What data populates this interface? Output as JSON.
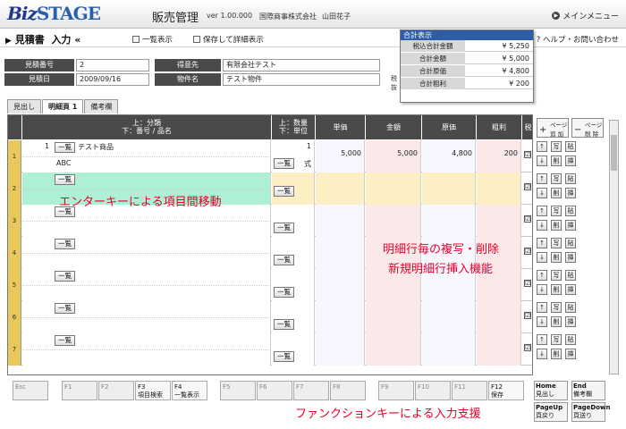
{
  "header": {
    "logo_part1": "Biz",
    "logo_part2": "STAGE",
    "app_name": "販売管理",
    "version": "ver 1.00.000",
    "company": "国際商事株式会社",
    "user": "山田花子",
    "main_menu": "メインメニュー"
  },
  "toolbar": {
    "title": "見積書",
    "mode": "入力",
    "list_view": "一覧表示",
    "save_detail": "保存して詳細表示",
    "help": "ヘルプ・お問い合わせ"
  },
  "info": {
    "quote_no_label": "見積番号",
    "quote_no": "2",
    "customer_label": "得意先",
    "customer": "有限会社テスト",
    "date_label": "見積日",
    "date": "2009/09/16",
    "project_label": "物件名",
    "project": "テスト物件"
  },
  "totals": {
    "title": "合計表示",
    "side_label": "税抜",
    "rows": [
      {
        "label": "税込合計金額",
        "value": "¥ 5,250"
      },
      {
        "label": "合計金額",
        "value": "¥ 5,000"
      },
      {
        "label": "合計原価",
        "value": "¥ 4,800"
      },
      {
        "label": "合計粗利",
        "value": "¥ 200"
      }
    ]
  },
  "tabs": [
    "見出し",
    "明細頁 1",
    "備考欄"
  ],
  "grid": {
    "headers": {
      "item_top": "上：分類",
      "item_bottom": "下：番号 / 品名",
      "qty_top": "上：数量",
      "qty_bottom": "下：単位",
      "unit_price": "単価",
      "amount": "金額",
      "cost": "原価",
      "profit": "粗利",
      "tax": "税"
    },
    "list_btn": "一覧",
    "rows": [
      {
        "num": "1",
        "line_no": "1",
        "name": "テスト商品",
        "sub": "ABC",
        "qty": "1",
        "unit": "式",
        "price": "5,000",
        "amount": "5,000",
        "cost": "4,800",
        "profit": "200"
      },
      {
        "num": "2"
      },
      {
        "num": "3"
      },
      {
        "num": "4"
      },
      {
        "num": "5"
      },
      {
        "num": "6"
      },
      {
        "num": "7"
      }
    ],
    "check": "☑"
  },
  "side_buttons": {
    "page_add_top": "ページ",
    "page_add_bottom": "追 加",
    "page_del_top": "ページ",
    "page_del_bottom": "削 除",
    "up": "↑",
    "down": "↓",
    "copy": "写",
    "paste": "貼",
    "delete": "削",
    "insert": "挿"
  },
  "fkeys": [
    {
      "key": "Esc",
      "label": ""
    },
    {
      "key": "F1",
      "label": ""
    },
    {
      "key": "F2",
      "label": ""
    },
    {
      "key": "F3",
      "label": "項目検索"
    },
    {
      "key": "F4",
      "label": "一覧表示"
    },
    {
      "key": "F5",
      "label": ""
    },
    {
      "key": "F6",
      "label": ""
    },
    {
      "key": "F7",
      "label": ""
    },
    {
      "key": "F8",
      "label": ""
    },
    {
      "key": "F9",
      "label": ""
    },
    {
      "key": "F10",
      "label": ""
    },
    {
      "key": "F11",
      "label": ""
    },
    {
      "key": "F12",
      "label": "保存"
    }
  ],
  "nav_keys": [
    {
      "key": "Home",
      "label": "見出し"
    },
    {
      "key": "End",
      "label": "備考欄"
    },
    {
      "key": "PageUp",
      "label": "頁戻り"
    },
    {
      "key": "PageDown",
      "label": "頁送り"
    }
  ],
  "annotations": {
    "enter_move": "エンターキーによる項目間移動",
    "copy_delete": "明細行毎の複写・削除",
    "new_row": "新規明細行挿入機能",
    "fkey_support": "ファンクションキーによる入力支援"
  },
  "colors": {
    "header_dark": "#4a4a4a",
    "row_number": "#e8c85a",
    "price_col": "#ffffff",
    "amount_col": "#fbe4e4",
    "highlight_row": "#fdefc4",
    "annotation": "#e8002a"
  }
}
